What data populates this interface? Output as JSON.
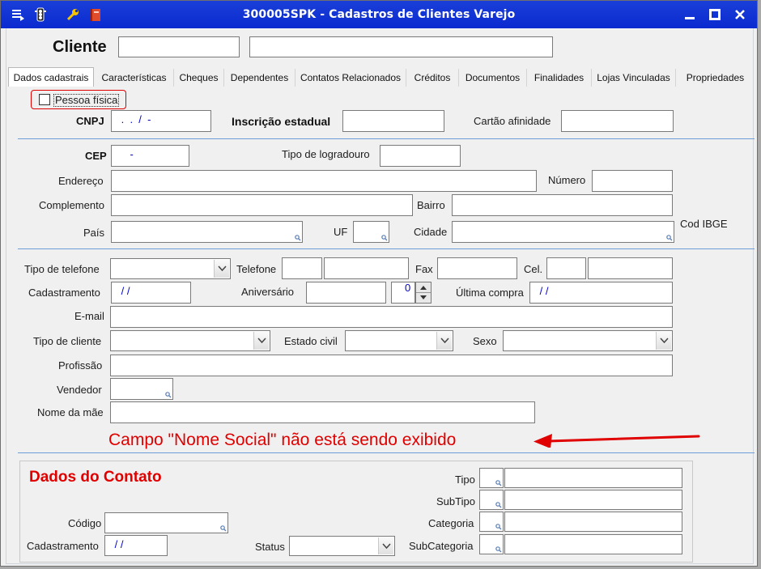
{
  "window": {
    "title": "300005SPK - Cadastros de Clientes Varejo"
  },
  "header": {
    "label": "Cliente",
    "code_value": "",
    "name_value": ""
  },
  "tabs": [
    {
      "label": "Dados cadastrais",
      "active": true
    },
    {
      "label": "Características"
    },
    {
      "label": "Cheques"
    },
    {
      "label": "Dependentes"
    },
    {
      "label": "Contatos Relacionados"
    },
    {
      "label": "Créditos"
    },
    {
      "label": "Documentos"
    },
    {
      "label": "Finalidades"
    },
    {
      "label": "Lojas Vinculadas"
    },
    {
      "label": "Propriedades"
    }
  ],
  "form": {
    "pessoa_fisica": {
      "label": "Pessoa física",
      "checked": false
    },
    "cnpj": {
      "label": "CNPJ",
      "value": " .  .  /  -"
    },
    "inscricao": {
      "label": "Inscrição estadual",
      "value": ""
    },
    "cartao": {
      "label": "Cartão afinidade",
      "value": ""
    },
    "cep": {
      "label": "CEP",
      "value": "    -"
    },
    "tipo_logradouro": {
      "label": "Tipo de logradouro",
      "value": ""
    },
    "endereco": {
      "label": "Endereço",
      "value": ""
    },
    "numero": {
      "label": "Número",
      "value": ""
    },
    "complemento": {
      "label": "Complemento",
      "value": ""
    },
    "bairro": {
      "label": "Bairro",
      "value": ""
    },
    "pais": {
      "label": "País",
      "value": ""
    },
    "uf": {
      "label": "UF",
      "value": ""
    },
    "cidade": {
      "label": "Cidade",
      "value": ""
    },
    "cod_ibge": {
      "label": "Cod IBGE"
    },
    "tipo_telefone": {
      "label": "Tipo de telefone",
      "value": ""
    },
    "telefone": {
      "label": "Telefone",
      "ddd": "",
      "value": ""
    },
    "fax": {
      "label": "Fax",
      "value": ""
    },
    "cel": {
      "label": "Cel.",
      "ddd": "",
      "value": ""
    },
    "cadastramento": {
      "label": "Cadastramento",
      "value": " / /"
    },
    "aniversario": {
      "label": "Aniversário",
      "value": "",
      "spin_value": "0"
    },
    "ultima_compra": {
      "label": "Última compra",
      "value": " / /"
    },
    "email": {
      "label": "E-mail",
      "value": ""
    },
    "tipo_cliente": {
      "label": "Tipo de cliente",
      "value": ""
    },
    "estado_civil": {
      "label": "Estado civil",
      "value": ""
    },
    "sexo": {
      "label": "Sexo",
      "value": ""
    },
    "profissao": {
      "label": "Profissão",
      "value": ""
    },
    "vendedor": {
      "label": "Vendedor",
      "value": ""
    },
    "nome_mae": {
      "label": "Nome da mãe",
      "value": ""
    }
  },
  "annotation": {
    "text": "Campo \"Nome Social\" não está sendo exibido",
    "color": "#e00000"
  },
  "contato": {
    "title": "Dados do Contato",
    "codigo": {
      "label": "Código",
      "value": ""
    },
    "cadastramento": {
      "label": "Cadastramento",
      "value": " / /"
    },
    "status": {
      "label": "Status",
      "value": ""
    },
    "tipo": {
      "label": "Tipo"
    },
    "subtipo": {
      "label": "SubTipo"
    },
    "categoria": {
      "label": "Categoria"
    },
    "subcategoria": {
      "label": "SubCategoria"
    }
  },
  "colors": {
    "titlebar": "#0b2ad0",
    "accent_red": "#e00000",
    "separator": "#6b9dd8",
    "masked_text": "#0000cc"
  }
}
